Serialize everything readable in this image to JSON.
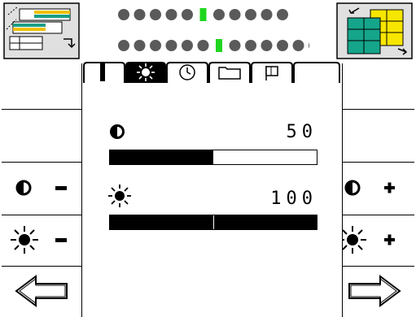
{
  "status": {
    "row1_total": 11,
    "row1_active_index": 5,
    "row2_total": 13,
    "row2_active_index": 6
  },
  "tabs": [
    {
      "name": "info",
      "icon": "info-i-icon",
      "selected": false
    },
    {
      "name": "display",
      "icon": "sun-icon",
      "selected": true
    },
    {
      "name": "clock",
      "icon": "clock-icon",
      "selected": false
    },
    {
      "name": "folder",
      "icon": "folder-icon",
      "selected": false
    },
    {
      "name": "flag",
      "icon": "flag-icon",
      "selected": false
    },
    {
      "name": "blank",
      "icon": "",
      "selected": false
    }
  ],
  "contrast": {
    "label_icon": "contrast-icon",
    "value": "50",
    "level": 0.5
  },
  "brightness": {
    "label_icon": "sun-icon",
    "value": "100",
    "level": 1.0
  },
  "left_buttons": [
    "display-settings-icon",
    "",
    "",
    "contrast-minus",
    "brightness-minus",
    "back-arrow-icon"
  ],
  "right_buttons": [
    "window-layout-icon",
    "",
    "",
    "contrast-plus",
    "brightness-plus",
    "forward-arrow-icon"
  ],
  "colors": {
    "accent_green": "#1fd61f",
    "dot_gray": "#5a5a5a",
    "teal": "#15a58a",
    "yellow": "#f7e600"
  }
}
